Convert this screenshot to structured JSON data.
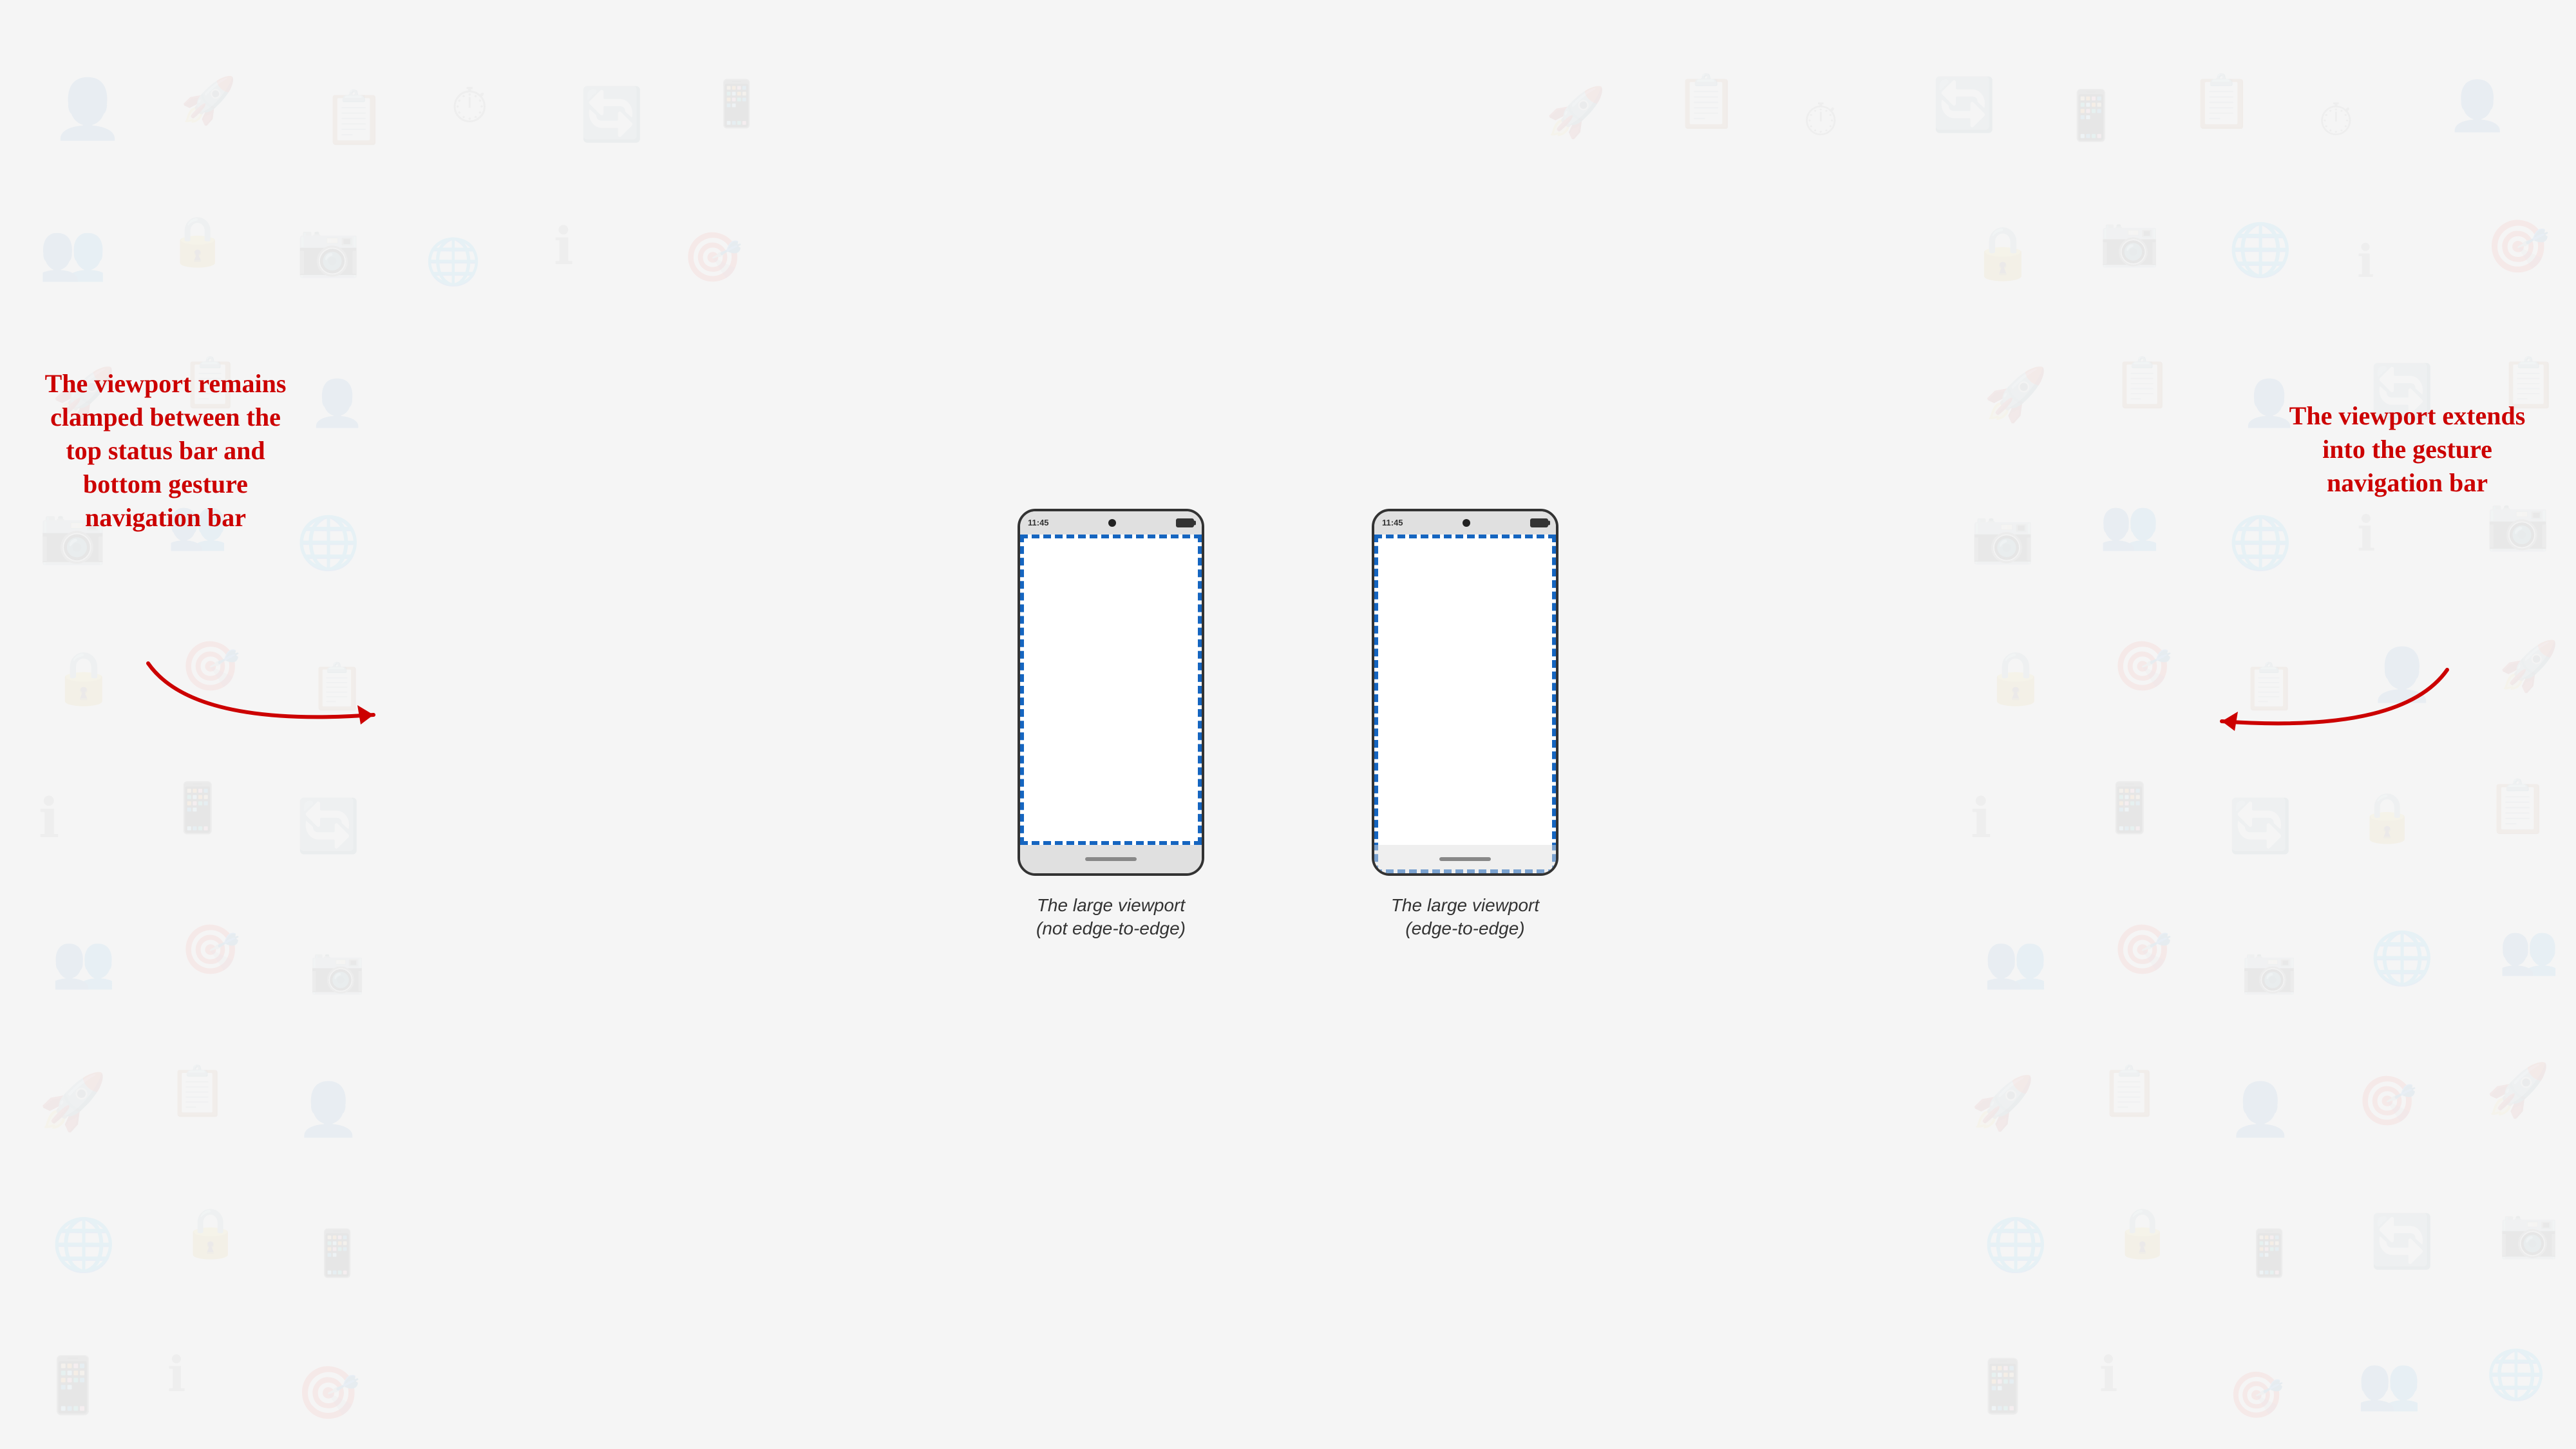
{
  "page": {
    "background_color": "#f5f5f5"
  },
  "phones": [
    {
      "id": "phone-left",
      "type": "not-edge-to-edge",
      "status_time": "11:45",
      "caption_line1": "The large viewport",
      "caption_line2": "(not edge-to-edge)"
    },
    {
      "id": "phone-right",
      "type": "edge-to-edge",
      "status_time": "11:45",
      "caption_line1": "The large viewport",
      "caption_line2": "(edge-to-edge)"
    }
  ],
  "annotations": {
    "left": {
      "text": "The viewport remains clamped between the top status bar and bottom gesture navigation bar"
    },
    "right": {
      "text": "The viewport extends into the gesture navigation bar"
    }
  }
}
